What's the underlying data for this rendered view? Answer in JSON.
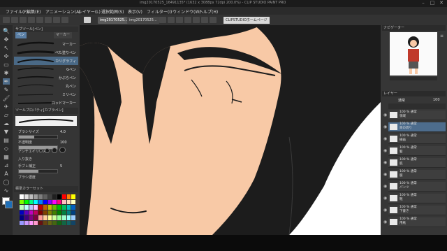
{
  "window": {
    "title": "img20170525_16491135* (1632 x 3088px 72dpi 200.0%) - CLIP STUDIO PAINT PRO",
    "controls": [
      "–",
      "□",
      "✕"
    ]
  },
  "menu": [
    "ファイル(F)",
    "編集(E)",
    "アニメーション(A)",
    "レイヤー(L)",
    "選択範囲(S)",
    "表示(V)",
    "フィルター(I)",
    "ウィンドウ(W)",
    "ヘルプ(H)"
  ],
  "tabs": [
    "img20170525...",
    "img20170525..."
  ],
  "studio_button": "CLIPSTUDIOホームページ",
  "subtool": {
    "panel_title": "サブツール[ペン]",
    "tabs": [
      "ペン",
      "マーカー"
    ],
    "brushes": [
      "マーカー",
      "ベた塗りペン",
      "カリグラフィ",
      "Gペン",
      "かぶらペン",
      "丸ペン",
      "ミリペン",
      "ロッドマーカー"
    ],
    "selected_brush": 2
  },
  "tool_property": {
    "title": "ツールプロパティ[カブラペン]",
    "brush_size_label": "ブラシサイズ",
    "brush_size_value": "4.0",
    "opacity_label": "不透明度",
    "opacity_value": "100",
    "anti_alias_label": "アンチエイリアス",
    "stabilization_label": "手ブレ補正",
    "stabilization_value": "5",
    "taper_label": "入り抜き",
    "start_end_label": "ブラシ濃度",
    "brush_size_level": 0.4,
    "opacity_level": 1.0,
    "stabilization_level": 0.5
  },
  "palette": {
    "title": "標準カラーセット",
    "colors": [
      "#ffffff",
      "#e0e0e0",
      "#bfbfbf",
      "#9f9f9f",
      "#7f7f7f",
      "#5f5f5f",
      "#3f3f3f",
      "#202020",
      "#000000",
      "#ff0000",
      "#ff8000",
      "#ffff00",
      "#80ff00",
      "#00ff00",
      "#00ff80",
      "#00ffff",
      "#0080ff",
      "#0000ff",
      "#8000ff",
      "#ff00ff",
      "#ff0080",
      "#ffc0c0",
      "#ffe0c0",
      "#ffffc0",
      "#c0ffc0",
      "#c0ffff",
      "#c0c0ff",
      "#ffc0ff",
      "#c00000",
      "#c06000",
      "#c0c000",
      "#60c000",
      "#00c000",
      "#00c060",
      "#00c0c0",
      "#0060c0",
      "#0000c0",
      "#6000c0",
      "#c000c0",
      "#c00060",
      "#800000",
      "#804000",
      "#808000",
      "#408000",
      "#008000",
      "#008040",
      "#008080",
      "#004080",
      "#000080",
      "#400080",
      "#800080",
      "#800040",
      "#ff9999",
      "#ffcc99",
      "#ffff99",
      "#ccff99",
      "#99ff99",
      "#99ffcc",
      "#99ffff",
      "#99ccff",
      "#9999ff",
      "#cc99ff",
      "#ff99ff",
      "#ff99cc",
      "#661111",
      "#664411",
      "#666611",
      "#446611",
      "#116611",
      "#116644",
      "#116666",
      "#114466"
    ]
  },
  "right_panel": {
    "navigator_title": "ナビゲーター",
    "layer_panel_title": "レイヤー",
    "blend_mode": "通常",
    "opacity": "100",
    "layers": [
      {
        "name": "100 % 通常\n領域"
      },
      {
        "name": "100 % 通常\n目の周り"
      },
      {
        "name": "100 % 通常\n線画"
      },
      {
        "name": "100 % 通常\n髪"
      },
      {
        "name": "100 % 通常\n肌"
      },
      {
        "name": "100 % 通常\n服"
      },
      {
        "name": "100 % 通常\nパンツ"
      },
      {
        "name": "100 % 通常\n靴"
      },
      {
        "name": "100 % 通常\n下書き"
      },
      {
        "name": "100 % 通常\n用紙"
      }
    ],
    "selected_layer": 1
  }
}
